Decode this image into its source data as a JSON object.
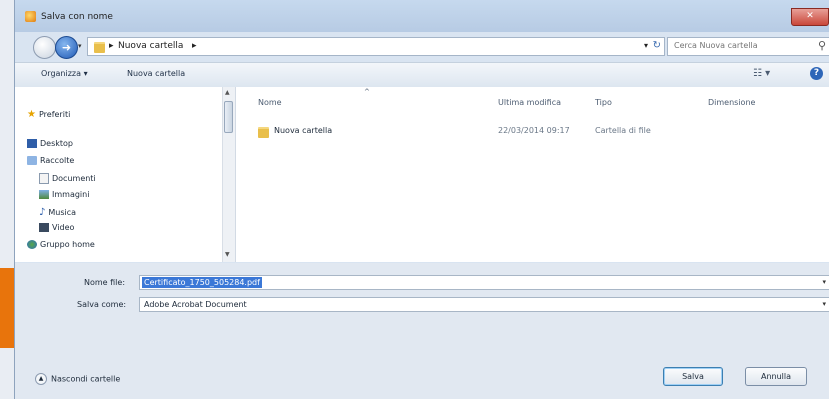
{
  "window": {
    "title": "Salva con nome",
    "close_glyph": "✕"
  },
  "address": {
    "crumbs": [
      "Nuova cartella"
    ],
    "search_placeholder": "Cerca Nuova cartella"
  },
  "toolbar": {
    "organize": "Organizza ▾",
    "new_folder": "Nuova cartella",
    "view_glyph": "☷ ▾",
    "help_glyph": "?"
  },
  "sidebar": {
    "favorites": "Preferiti",
    "desktop": "Desktop",
    "libraries": "Raccolte",
    "documents": "Documenti",
    "images": "Immagini",
    "music": "Musica",
    "video": "Video",
    "homegroup": "Gruppo home"
  },
  "columns": {
    "name": "Nome",
    "modified": "Ultima modifica",
    "type": "Tipo",
    "size": "Dimensione"
  },
  "files": [
    {
      "name": "Nuova cartella",
      "modified": "22/03/2014 09:17",
      "type": "Cartella di file"
    }
  ],
  "form": {
    "filename_label": "Nome file:",
    "filename_value": "Certificato_1750_505284.pdf",
    "savetype_label": "Salva come:",
    "savetype_value": "Adobe Acrobat Document"
  },
  "footer": {
    "hide_folders": "Nascondi cartelle",
    "save": "Salva",
    "cancel": "Annulla"
  },
  "colors": {
    "accent_arrow": "#e8740c",
    "selection": "#3b78d7"
  }
}
